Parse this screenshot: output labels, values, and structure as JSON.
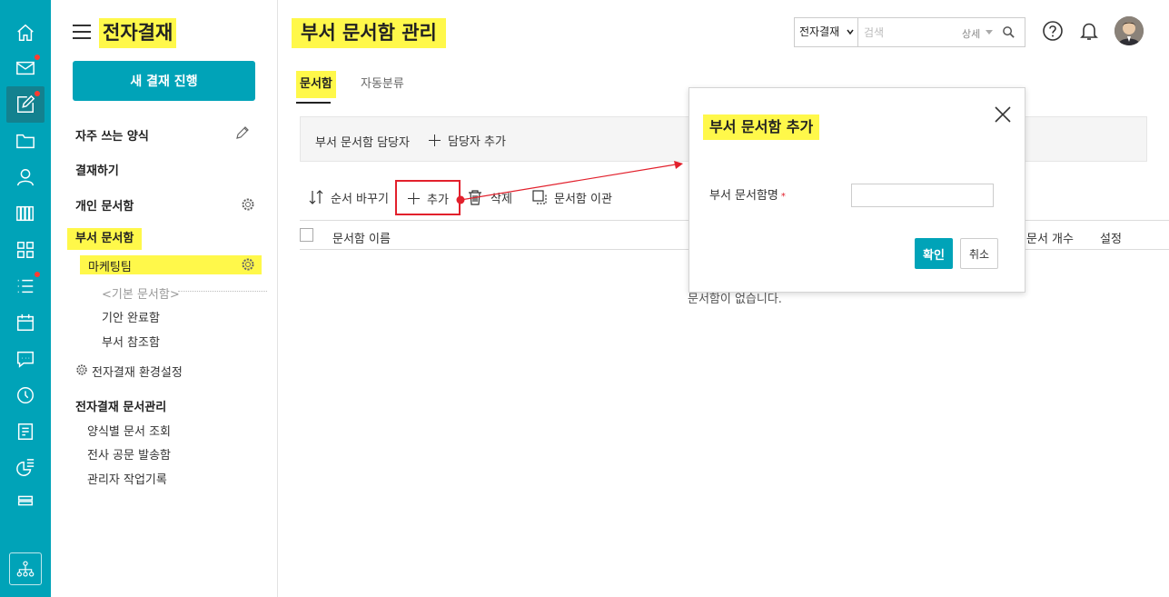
{
  "colors": {
    "accent": "#00a3b8",
    "highlight": "#fff84a",
    "annotation": "#e2202c",
    "notification_dot": "#ff3b30"
  },
  "rail": {
    "icons": [
      "home-icon",
      "mail-icon",
      "approval-icon",
      "folder-icon",
      "user-icon",
      "library-icon",
      "apps-icon",
      "list-icon",
      "calendar-icon",
      "chat-icon",
      "clock-icon",
      "report-icon",
      "chart-icon",
      "storage-icon"
    ],
    "bottom_icon": "org-chart-icon"
  },
  "sidebar": {
    "app_title": "전자결재",
    "new_button": "새 결재 진행",
    "favorites": "자주 쓰는 양식",
    "approve": "결재하기",
    "personal_box": "개인 문서함",
    "dept_box": "부서 문서함",
    "team": "마케팅팀",
    "default_box": "<기본 문서함>",
    "draft_done": "기안 완료함",
    "dept_ref": "부서 참조함",
    "settings": "전자결재 환경설정",
    "doc_mgmt": "전자결재 문서관리",
    "by_form": "양식별 문서 조회",
    "official_outbox": "전사 공문 발송함",
    "admin_log": "관리자 작업기록"
  },
  "header": {
    "page_title": "부서 문서함 관리",
    "search_scope": "전자결재",
    "search_placeholder": "검색",
    "search_detail": "상세"
  },
  "tabs": {
    "active": "문서함",
    "other": "자동분류"
  },
  "manager": {
    "label": "부서 문서함 담당자",
    "add": "담당자 추가"
  },
  "toolbar": {
    "reorder": "순서 바꾸기",
    "add": "추가",
    "delete": "삭제",
    "transfer": "문서함 이관"
  },
  "table": {
    "col_name": "문서함 이름",
    "col_count": "문서 개수",
    "col_settings": "설정",
    "empty": "문서함이 없습니다."
  },
  "modal": {
    "title": "부서 문서함 추가",
    "field_label": "부서 문서함명",
    "required_mark": "*",
    "field_value": "",
    "ok": "확인",
    "cancel": "취소"
  }
}
